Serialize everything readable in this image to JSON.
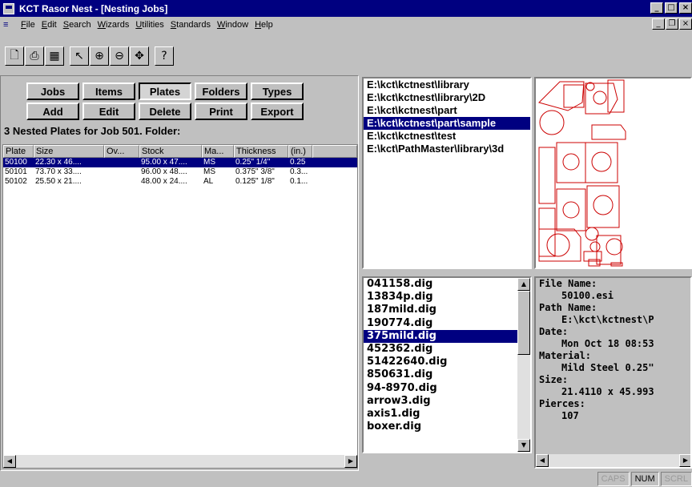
{
  "window": {
    "title": "KCT Rasor Nest - [Nesting Jobs]"
  },
  "menu": [
    "File",
    "Edit",
    "Search",
    "Wizards",
    "Utilities",
    "Standards",
    "Window",
    "Help"
  ],
  "toolbar": {
    "icons": [
      "new-doc-icon",
      "print-icon",
      "grid-icon",
      "arrow-select-icon",
      "zoom-in-icon",
      "zoom-out-icon",
      "pan-icon",
      "help-icon"
    ],
    "help_glyph": "?"
  },
  "buttons_row1": [
    "Jobs",
    "Items",
    "Plates",
    "Folders",
    "Types"
  ],
  "buttons_row2": [
    "Add",
    "Edit",
    "Delete",
    "Print",
    "Export"
  ],
  "caption": "3 Nested Plates for Job 501. Folder:",
  "plates_table": {
    "columns": [
      "Plate",
      "Size",
      "Ov...",
      "Stock",
      "Ma...",
      "Thickness",
      "(in.)"
    ],
    "rows": [
      [
        "50100",
        "22.30 x 46....",
        "",
        "95.00 x 47....",
        "MS",
        "0.25\"  1/4\"",
        "0.25"
      ],
      [
        "50101",
        "73.70 x 33....",
        "",
        "96.00 x 48....",
        "MS",
        "0.375\"  3/8\"",
        "0.3..."
      ],
      [
        "50102",
        "25.50 x 21....",
        "",
        "48.00 x 24....",
        "AL",
        "0.125\"  1/8\"",
        "0.1..."
      ]
    ],
    "selected_row": 0
  },
  "folders": {
    "items": [
      "E:\\kct\\kctnest\\library",
      "E:\\kct\\kctnest\\library\\2D",
      "E:\\kct\\kctnest\\part",
      "E:\\kct\\kctnest\\part\\sample",
      "E:\\kct\\kctnest\\test",
      "E:\\kct\\PathMaster\\library\\3d"
    ],
    "selected": 3
  },
  "files": {
    "items": [
      "041158.dig",
      "13834p.dig",
      "187mild.dig",
      "190774.dig",
      "375mild.dig",
      "452362.dig",
      "51422640.dig",
      "850631.dig",
      "94-8970.dig",
      "arrow3.dig",
      "axis1.dig",
      "boxer.dig"
    ],
    "selected": 4
  },
  "info": {
    "file_name_label": "File Name:",
    "file_name": "50100.esi",
    "path_label": "Path Name:",
    "path": "E:\\kct\\kctnest\\P",
    "date_label": "Date:",
    "date": "Mon Oct 18 08:53",
    "material_label": "Material:",
    "material": "Mild Steel 0.25\"",
    "size_label": "Size:",
    "size": "21.4110 x 45.993",
    "pierces_label": "Pierces:",
    "pierces": "107"
  },
  "status": {
    "caps": "CAPS",
    "num": "NUM",
    "scrl": "SCRL"
  },
  "colors": {
    "selection": "#000080",
    "preview_stroke": "#cc0000"
  }
}
